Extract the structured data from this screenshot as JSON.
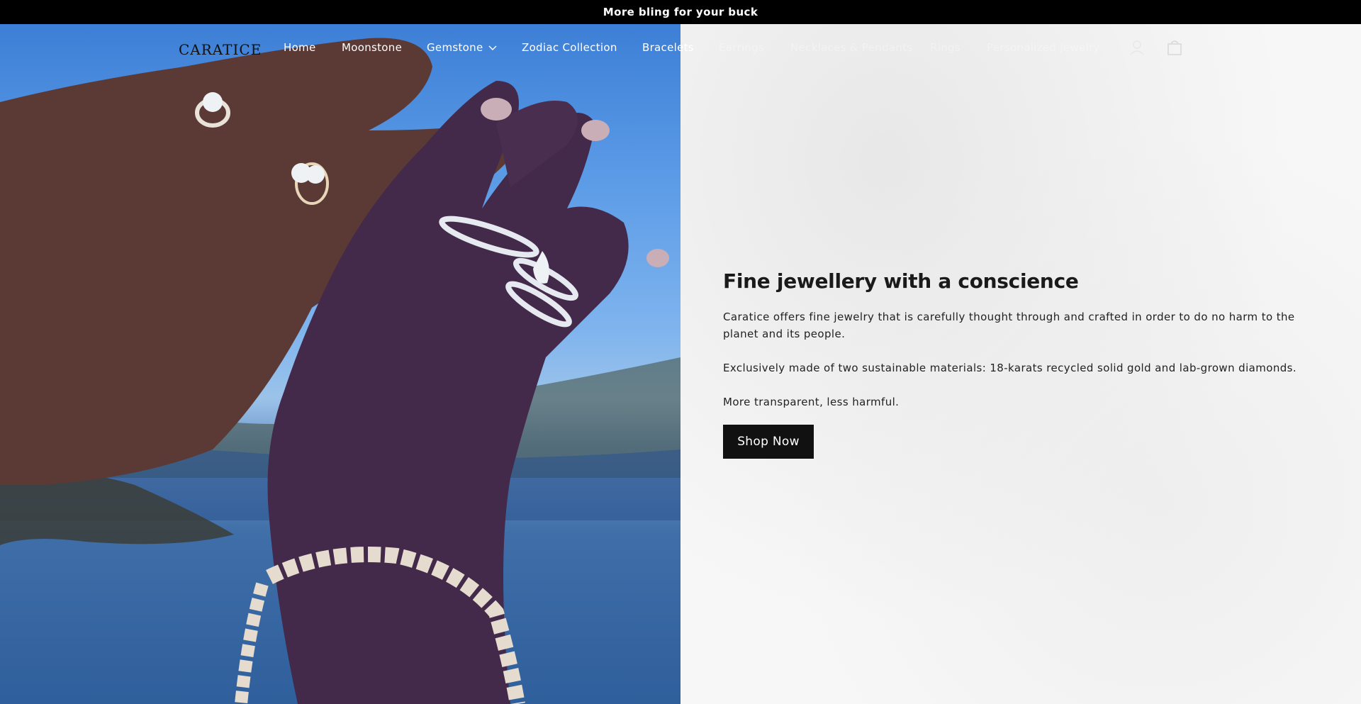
{
  "announcement": {
    "text": "More bling for your buck"
  },
  "header": {
    "logo": "CARATICE",
    "nav": [
      {
        "label": "Home"
      },
      {
        "label": "Moonstone"
      },
      {
        "label": "Gemstone"
      },
      {
        "label": "Zodiac Collection"
      },
      {
        "label": "Bracelets"
      },
      {
        "label": "Earrings"
      },
      {
        "label": "Necklaces & Pendants"
      },
      {
        "label": "Rings"
      },
      {
        "label": "Personalized Jewelry"
      }
    ],
    "icons": {
      "account": "user-icon",
      "cart": "bag-icon"
    }
  },
  "hero": {
    "image": "hands-with-diamond-rings-and-bracelet-over-sea",
    "heading": "Fine jewellery with a conscience",
    "paragraphs": [
      "Caratice offers fine jewelry that is carefully thought through and crafted in order to do no harm to the planet and its people.",
      "Exclusively made of two sustainable materials: 18-karats recycled solid gold and lab-grown diamonds.",
      "More transparent, less harmful."
    ],
    "cta": "Shop Now"
  },
  "colors": {
    "announcement_bg": "#000000",
    "button_bg": "#111111",
    "panel_bg": "#f7f7f7"
  }
}
